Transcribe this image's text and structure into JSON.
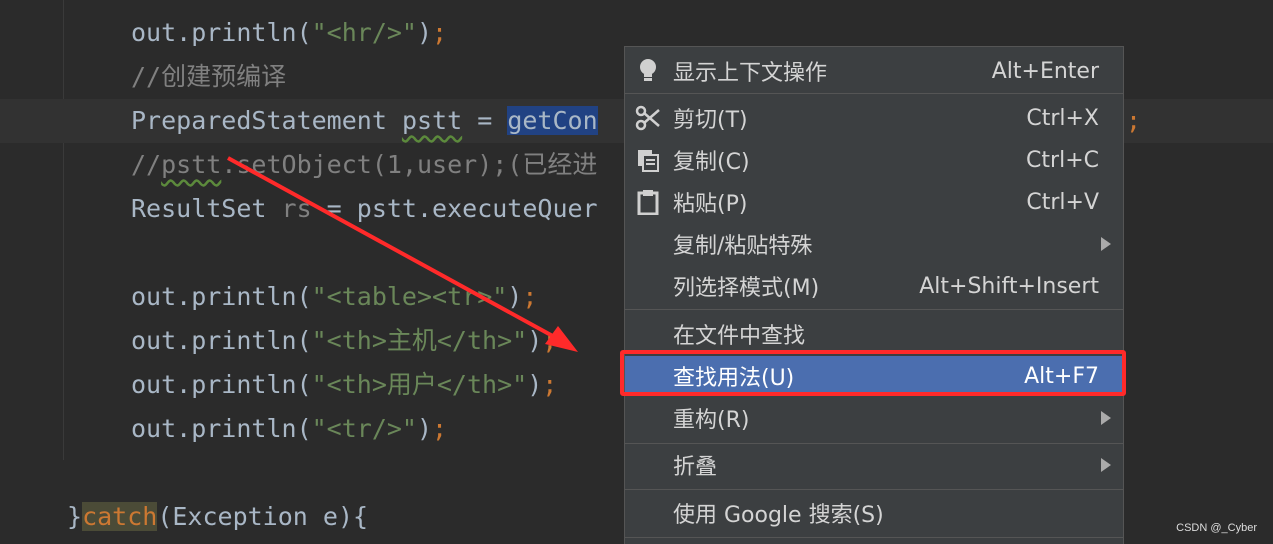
{
  "editor": {
    "line1": {
      "pre": "out.println(",
      "str": "\"<hr/>\"",
      "post": ")",
      "semi": ";"
    },
    "line2": {
      "comment": "//创建预编译"
    },
    "line3": {
      "type": "PreparedStatement ",
      "var": "pstt",
      "eq": " = ",
      "sel": "getCon",
      "semi": ";"
    },
    "line4": {
      "comment_a": "//",
      "comment_var": "pstt",
      "comment_b": ".setObject(1,user);(已经进"
    },
    "line5": {
      "text": "ResultSet ",
      "var": "rs",
      "rest": " = pstt.executeQuer"
    },
    "line6": {
      "pre": "out.println(",
      "str": "\"<table><tr>\"",
      "post": ")",
      "semi": ";"
    },
    "line7": {
      "pre": "out.println(",
      "str": "\"<th>主机</th>\"",
      "post": ")",
      "semi": ";"
    },
    "line8": {
      "pre": "out.println(",
      "str": "\"<th>用户</th>\"",
      "post": ")",
      "semi": ";"
    },
    "line9": {
      "pre": "out.println(",
      "str": "\"<tr/>\"",
      "post": ")",
      "semi": ";"
    },
    "line10": {
      "brace": "}",
      "kw": "catch",
      "rest": "(Exception e){"
    }
  },
  "context_menu": {
    "items": [
      {
        "icon": "lightbulb-icon",
        "label": "显示上下文操作",
        "shortcut": "Alt+Enter"
      },
      {
        "icon": "scissors-icon",
        "label": "剪切(T)",
        "shortcut": "Ctrl+X"
      },
      {
        "icon": "copy-icon",
        "label": "复制(C)",
        "shortcut": "Ctrl+C"
      },
      {
        "icon": "clipboard-icon",
        "label": "粘贴(P)",
        "shortcut": "Ctrl+V"
      },
      {
        "label": "复制/粘贴特殊",
        "submenu": true
      },
      {
        "label": "列选择模式(M)",
        "shortcut": "Alt+Shift+Insert"
      },
      {
        "label": "在文件中查找"
      },
      {
        "label": "查找用法(U)",
        "shortcut": "Alt+F7",
        "active": true
      },
      {
        "label": "重构(R)",
        "submenu": true
      },
      {
        "label": "折叠",
        "submenu": true
      },
      {
        "label": "使用 Google 搜索(S)"
      }
    ]
  },
  "watermark": "CSDN @_Cyber",
  "colors": {
    "accent": "#4b6eaf",
    "annotation": "#ff2a2a"
  }
}
